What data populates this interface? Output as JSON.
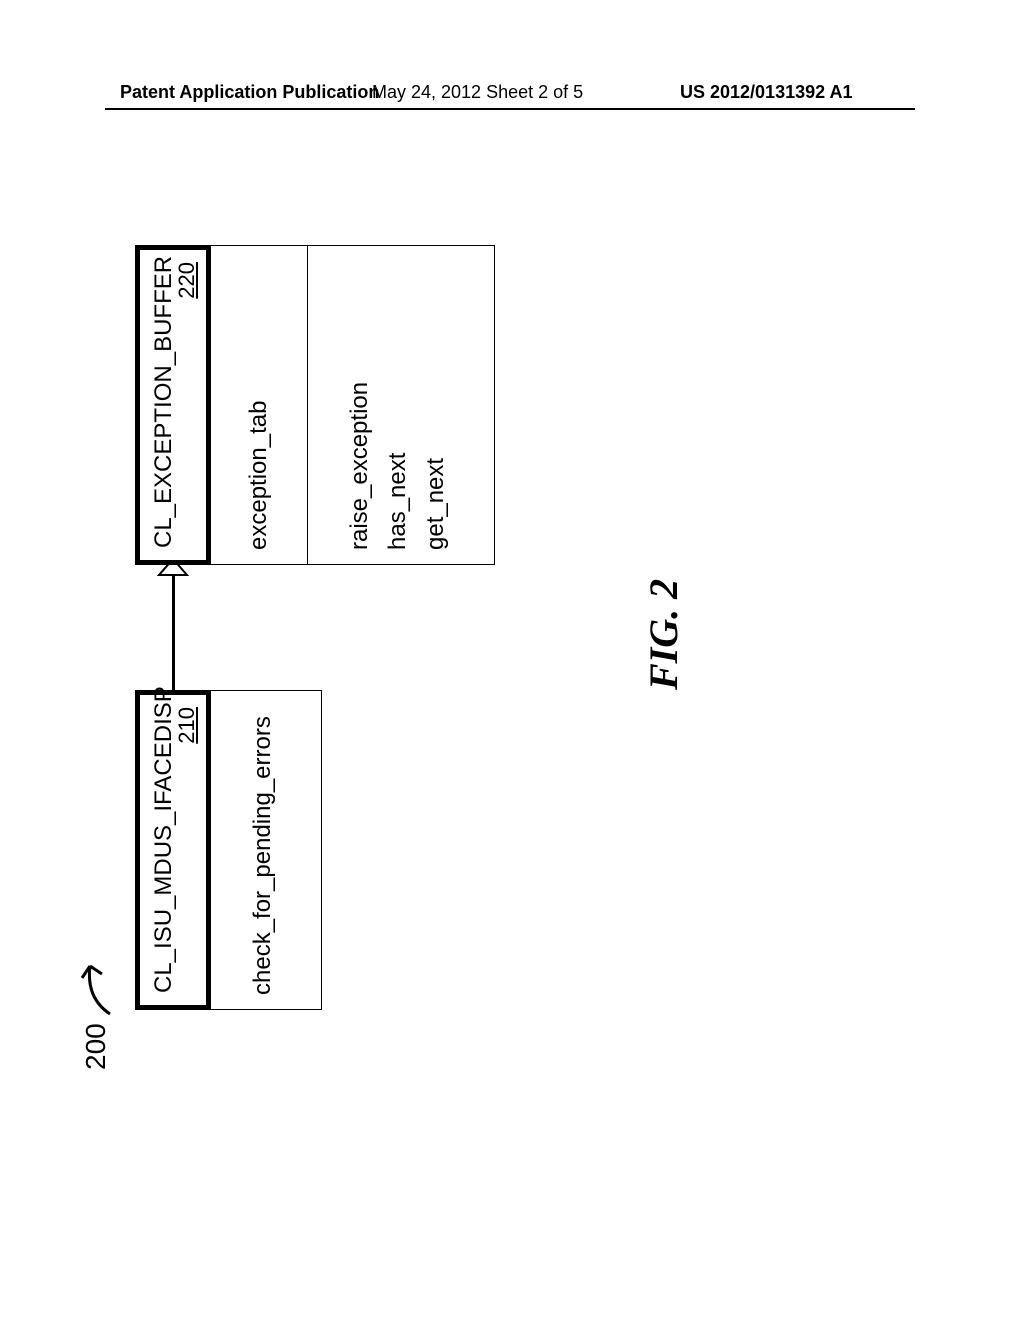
{
  "header": {
    "left": "Patent Application Publication",
    "middle": "May 24, 2012  Sheet 2 of 5",
    "right": "US 2012/0131392 A1"
  },
  "diagram": {
    "overall_ref": "200",
    "left_class": {
      "name": "CL_ISU_MDUS_IFACEDISP",
      "ref": "210",
      "attributes": [],
      "methods": [
        "check_for_pending_errors"
      ]
    },
    "right_class": {
      "name": "CL_EXCEPTION_BUFFER",
      "ref": "220",
      "attributes": [
        "exception_tab"
      ],
      "methods": [
        "raise_exception",
        "has_next",
        "get_next"
      ]
    }
  },
  "figure_caption": "FIG. 2"
}
